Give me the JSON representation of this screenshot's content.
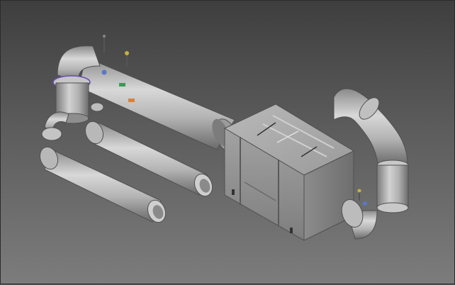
{
  "viewport": {
    "description_label": "",
    "background_top": "#3e3e3e",
    "background_bottom": "#7c7c7c"
  },
  "palette": {
    "metal_light": "#d6d6d6",
    "metal_mid": "#a8a8a8",
    "metal_dark": "#6e6e6e",
    "edge": "#4a4a4a",
    "accent_purple": "#6a4fb3",
    "valve_yellow": "#c8b040",
    "valve_green": "#3c9a54",
    "valve_orange": "#d8823a",
    "valve_blue": "#5a78c8"
  },
  "components": {
    "main_duct": "main-duct",
    "elbow_top_left": "elbow",
    "inlet_duct_upper": "inlet-duct",
    "inlet_duct_lower": "inlet-duct",
    "housing_unit": "housing",
    "outlet_elbow": "outlet-elbow"
  }
}
